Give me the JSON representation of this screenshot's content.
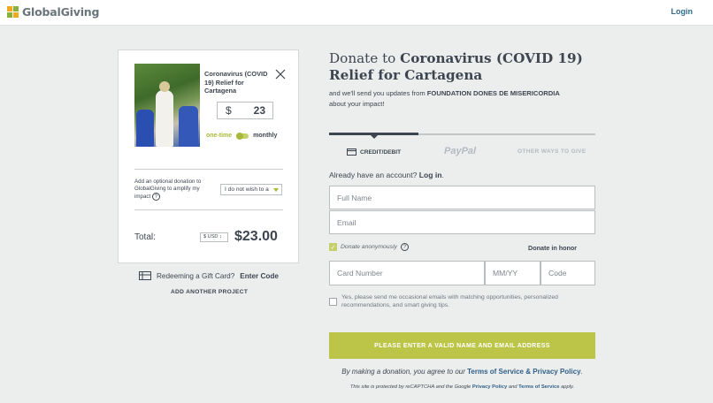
{
  "header": {
    "logo_text": "GlobalGiving",
    "login_label": "Login"
  },
  "project_card": {
    "title": "Coronavirus (COVID 19) Relief for Cartagena",
    "currency_symbol": "$",
    "amount": "23",
    "frequency_one_time": "one-time",
    "frequency_monthly": "monthly",
    "optional_donation_text": "Add an optional donation to GlobalGiving to amplify my impact",
    "optional_help": "?",
    "optional_select_value": "I do not wish to a",
    "total_label": "Total:",
    "currency_select": "$ USD ↕",
    "total_value": "$23.00"
  },
  "gift_card": {
    "prefix": "Redeeming a Gift Card?",
    "link": "Enter Code"
  },
  "add_project_label": "ADD ANOTHER PROJECT",
  "donate": {
    "heading_prefix": "Donate to",
    "heading_project": "Coronavirus (COVID 19) Relief for Cartagena",
    "sub_prefix": "and we'll send you updates from",
    "sub_org": "FOUNDATION DONES DE MISERICORDIA",
    "sub_suffix": "about your impact!"
  },
  "payment_tabs": {
    "credit": "CREDIT/DEBIT",
    "paypal": "PayPal",
    "other": "OTHER WAYS TO GIVE"
  },
  "account": {
    "prefix": "Already have an account?",
    "link": "Log in",
    "suffix": "."
  },
  "form": {
    "full_name_placeholder": "Full Name",
    "email_placeholder": "Email",
    "anonymous_label": "Donate anonymously",
    "anonymous_help": "?",
    "honor_label": "Donate in honor",
    "card_number_placeholder": "Card Number",
    "mmyy_placeholder": "MM/YY",
    "code_placeholder": "Code",
    "emails_optin": "Yes, please send me occasional emails with matching opportunities, personalized recommendations, and smart giving tips.",
    "submit_label": "PLEASE ENTER A VALID NAME AND EMAIL ADDRESS"
  },
  "terms": {
    "prefix": "By making a donation, you agree to our",
    "tos": "Terms of Service",
    "amp": "&",
    "privacy": "Privacy Policy",
    "end": "."
  },
  "recaptcha": {
    "prefix": "This site is protected by reCAPTCHA and the Google",
    "privacy": "Privacy Policy",
    "and": "and",
    "tos": "Terms of Service",
    "suffix": "apply."
  },
  "colors": {
    "accent_green": "#bdc549",
    "link_blue": "#2f5f86",
    "text_dark": "#3d4650",
    "background": "#eceeee"
  }
}
